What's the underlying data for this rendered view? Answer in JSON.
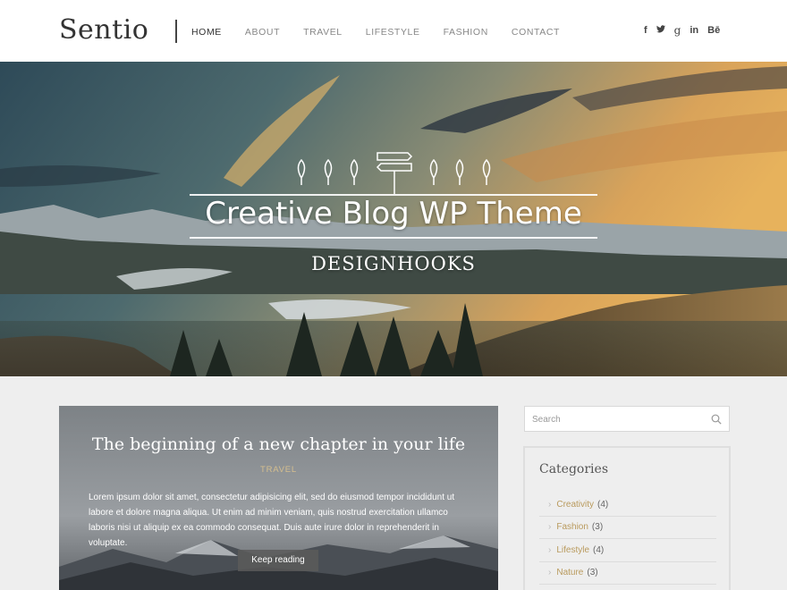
{
  "header": {
    "logo": "Sentio",
    "nav": [
      "HOME",
      "ABOUT",
      "TRAVEL",
      "LIFESTYLE",
      "FASHION",
      "CONTACT"
    ],
    "social": [
      {
        "icon": "facebook-icon",
        "glyph": "f"
      },
      {
        "icon": "twitter-icon",
        "glyph": "t"
      },
      {
        "icon": "googleplus-icon",
        "glyph": "g"
      },
      {
        "icon": "linkedin-icon",
        "glyph": "in"
      },
      {
        "icon": "behance-icon",
        "glyph": "Bē"
      }
    ]
  },
  "hero": {
    "title": "Creative Blog WP Theme",
    "subtitle": "DESIGNHOOKS"
  },
  "post": {
    "title": "The beginning of a new chapter in your life",
    "category": "TRAVEL",
    "excerpt": "Lorem ipsum dolor sit amet, consectetur adipisicing elit, sed do eiusmod tempor incididunt ut labore et dolore magna aliqua. Ut enim ad minim veniam, quis nostrud exercitation ullamco laboris nisi ut aliquip ex ea commodo consequat. Duis aute irure dolor in reprehenderit in voluptate.",
    "button": "Keep reading"
  },
  "sidebar": {
    "search_placeholder": "Search",
    "categories_title": "Categories",
    "categories": [
      {
        "name": "Creativity",
        "count": "(4)"
      },
      {
        "name": "Fashion",
        "count": "(3)"
      },
      {
        "name": "Lifestyle",
        "count": "(4)"
      },
      {
        "name": "Nature",
        "count": "(3)"
      }
    ]
  },
  "colors": {
    "accent": "#b99a5d",
    "background": "#eeeeee"
  }
}
